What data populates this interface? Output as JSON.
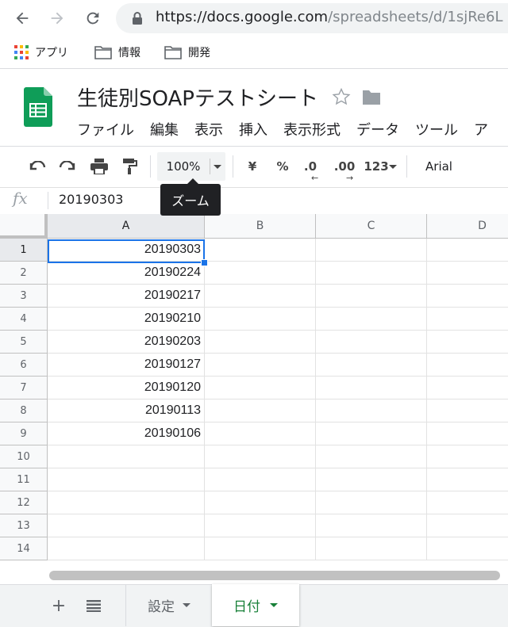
{
  "browser": {
    "url_host": "https://docs.google.com",
    "url_path": "/spreadsheets/d/1sjRe6L",
    "bookmarks": [
      {
        "label": "アプリ",
        "icon": "apps-grid-icon"
      },
      {
        "label": "情報",
        "icon": "folder-icon"
      },
      {
        "label": "開発",
        "icon": "folder-icon"
      }
    ]
  },
  "doc": {
    "title": "生徒別SOAPテストシート",
    "menu": [
      "ファイル",
      "編集",
      "表示",
      "挿入",
      "表示形式",
      "データ",
      "ツール",
      "ア"
    ]
  },
  "toolbar": {
    "zoom": "100%",
    "tooltip": "ズーム",
    "currency": "¥",
    "percent": "%",
    "dec_less": ".0",
    "dec_more": ".00",
    "format_more": "123",
    "font": "Arial"
  },
  "formula": {
    "fx": "fx",
    "value": "20190303"
  },
  "grid": {
    "columns": [
      "A",
      "B",
      "C",
      "D"
    ],
    "rows": [
      "1",
      "2",
      "3",
      "4",
      "5",
      "6",
      "7",
      "8",
      "9",
      "10",
      "11",
      "12",
      "13",
      "14"
    ],
    "col_a": [
      "20190303",
      "20190224",
      "20190217",
      "20190210",
      "20190203",
      "20190127",
      "20190120",
      "20190113",
      "20190106"
    ]
  },
  "sheets": {
    "tabs": [
      {
        "label": "設定",
        "active": false
      },
      {
        "label": "日付",
        "active": true
      }
    ],
    "active_color": "#188038"
  },
  "colors": {
    "accent": "#1a73e8",
    "sheets_green": "#0f9d58"
  }
}
